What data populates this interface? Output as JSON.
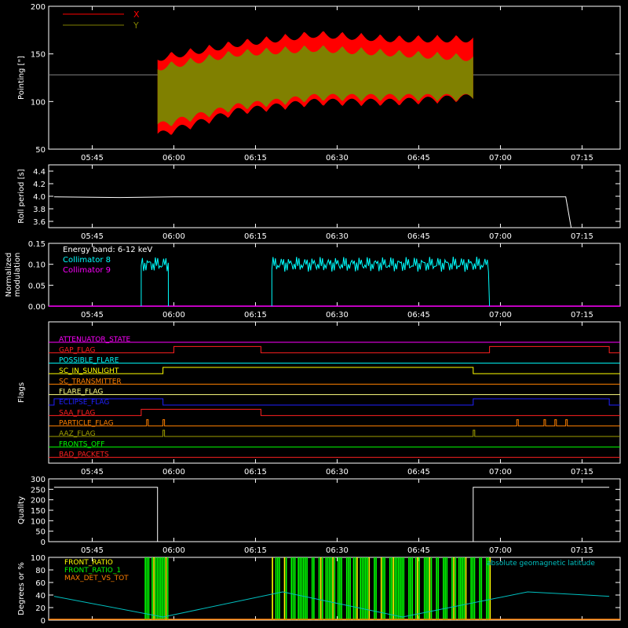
{
  "colors": {
    "background": "#000000",
    "axis": "#ffffff",
    "x_series": "#ff0000",
    "y_series": "#808000",
    "collimator8": "#00ffff",
    "collimator9": "#ff00ff",
    "front_ratio": "#ffff00",
    "front_ratio_1": "#00ff00",
    "max_det": "#ff8000",
    "latitude": "#00c0c0"
  },
  "time_ticks": [
    "05:45",
    "06:00",
    "06:15",
    "06:30",
    "06:45",
    "07:00",
    "07:15"
  ],
  "chart_data": [
    {
      "type": "area",
      "ylabel": "Pointing [\"]",
      "ylim": [
        50,
        200
      ],
      "yticks": [
        "50",
        "100",
        "150",
        "200"
      ],
      "legend": [
        "X",
        "Y"
      ],
      "series": [
        {
          "name": "X",
          "x": [
            "05:57",
            "06:10",
            "06:25",
            "06:40",
            "06:55"
          ],
          "upper": [
            150,
            165,
            175,
            170,
            170
          ],
          "lower": [
            60,
            85,
            95,
            95,
            100
          ]
        },
        {
          "name": "Y",
          "x": [
            "05:57",
            "06:10",
            "06:25",
            "06:40",
            "06:55"
          ],
          "upper": [
            140,
            155,
            160,
            155,
            150
          ],
          "lower": [
            70,
            90,
            100,
            100,
            100
          ]
        }
      ],
      "baseline": 128
    },
    {
      "type": "line",
      "ylabel": "Roll period [s]",
      "ylim": [
        3.5,
        4.5
      ],
      "yticks": [
        "3.6",
        "3.8",
        "4.0",
        "4.2",
        "4.4"
      ],
      "series": [
        {
          "x": [
            "05:38",
            "05:50",
            "06:00",
            "06:30",
            "07:00",
            "07:12",
            "07:13"
          ],
          "values": [
            3.99,
            3.98,
            3.99,
            3.99,
            3.99,
            3.99,
            3.5
          ]
        }
      ]
    },
    {
      "type": "line",
      "ylabel": "Normalized modulation",
      "ylim": [
        0,
        0.15
      ],
      "yticks": [
        "0.00",
        "0.05",
        "0.10",
        "0.15"
      ],
      "annotation": "Energy band: 6-12 keV",
      "legend": [
        "Collimator 8",
        "Collimator 9"
      ],
      "series": [
        {
          "name": "Collimator 8",
          "segments": [
            [
              "05:54",
              "05:59"
            ],
            [
              "06:18",
              "06:58"
            ]
          ],
          "mean": 0.1
        },
        {
          "name": "Collimator 9",
          "values": [
            0,
            0
          ]
        }
      ]
    },
    {
      "type": "line",
      "ylabel": "Flags",
      "flags": [
        {
          "name": "ATTENUATOR_STATE",
          "color": "#ff00ff",
          "high": []
        },
        {
          "name": "GAP_FLAG",
          "color": "#ff2020",
          "high": [
            [
              "06:00",
              "06:16"
            ],
            [
              "06:58",
              "07:20"
            ]
          ]
        },
        {
          "name": "POSSIBLE_FLARE",
          "color": "#00ffff",
          "high": []
        },
        {
          "name": "SC_IN_SUNLIGHT",
          "color": "#ffff00",
          "high": [
            [
              "05:58",
              "06:55"
            ]
          ]
        },
        {
          "name": "SC_TRANSMITTER",
          "color": "#ff8000",
          "high": []
        },
        {
          "name": "FLARE_FLAG",
          "color": "#ffff80",
          "high": []
        },
        {
          "name": "ECLIPSE_FLAG",
          "color": "#2020ff",
          "high": [
            [
              "05:38",
              "05:58"
            ],
            [
              "06:55",
              "07:20"
            ]
          ]
        },
        {
          "name": "SAA_FLAG",
          "color": "#ff2020",
          "high": [
            [
              "05:54",
              "06:16"
            ]
          ]
        },
        {
          "name": "PARTICLE_FLAG",
          "color": "#ff8000",
          "high": [
            [
              "05:55",
              "05:55"
            ],
            [
              "05:58",
              "05:58"
            ],
            [
              "07:03",
              "07:03"
            ],
            [
              "07:08",
              "07:08"
            ],
            [
              "07:10",
              "07:10"
            ],
            [
              "07:12",
              "07:12"
            ]
          ]
        },
        {
          "name": "AAZ_FLAG",
          "color": "#a0a000",
          "high": [
            [
              "05:58",
              "05:58"
            ],
            [
              "06:55",
              "06:55"
            ]
          ]
        },
        {
          "name": "FRONTS_OFF",
          "color": "#00ff00",
          "high": []
        },
        {
          "name": "BAD_PACKETS",
          "color": "#ff2020",
          "high": []
        }
      ]
    },
    {
      "type": "line",
      "ylabel": "Quality",
      "ylim": [
        0,
        300
      ],
      "yticks": [
        "0",
        "50",
        "100",
        "150",
        "200",
        "250",
        "300"
      ],
      "series": [
        {
          "x": [
            "05:38",
            "05:57",
            "05:57",
            "06:55",
            "06:55",
            "07:20"
          ],
          "values": [
            260,
            260,
            0,
            0,
            260,
            260
          ]
        }
      ]
    },
    {
      "type": "bar",
      "ylabel": "Degrees or %",
      "ylim": [
        0,
        100
      ],
      "yticks": [
        "0",
        "20",
        "40",
        "60",
        "80",
        "100"
      ],
      "legend": [
        "FRONT_RATIO",
        "FRONT_RATIO_1",
        "MAX_DET_VS_TOT"
      ],
      "annotation": "absolute geomagnetic latitude",
      "series": [
        {
          "name": "FRONT_RATIO",
          "segments": [
            [
              "05:54",
              "05:59"
            ],
            [
              "06:18",
              "06:58"
            ]
          ],
          "values": [
            100,
            100
          ]
        },
        {
          "name": "absolute geomagnetic latitude",
          "x": [
            "05:38",
            "05:58",
            "06:20",
            "06:42",
            "07:05",
            "07:20"
          ],
          "values": [
            38,
            5,
            45,
            5,
            45,
            38
          ]
        }
      ]
    }
  ]
}
